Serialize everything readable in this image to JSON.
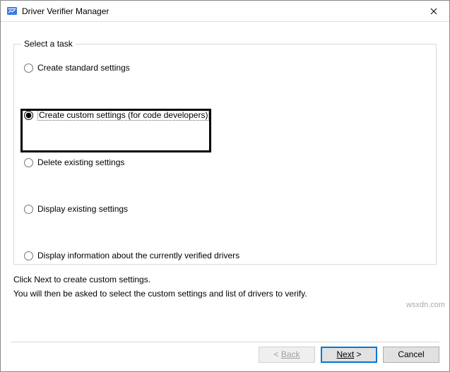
{
  "window": {
    "title": "Driver Verifier Manager"
  },
  "group": {
    "legend": "Select a task"
  },
  "options": {
    "create_standard": "Create standard settings",
    "create_custom": "Create custom settings (for code developers)",
    "delete_existing": "Delete existing settings",
    "display_existing": "Display existing settings",
    "display_info": "Display information about the currently verified drivers"
  },
  "selected_option": "create_custom",
  "instructions": {
    "line1": "Click Next to create custom settings.",
    "line2": "You will then be asked to select the custom settings and list of drivers to verify."
  },
  "buttons": {
    "back_prefix": "< ",
    "back_label": "Back",
    "next_label": "Next",
    "next_suffix": " >",
    "cancel": "Cancel"
  },
  "watermark": "wsxdn.com"
}
